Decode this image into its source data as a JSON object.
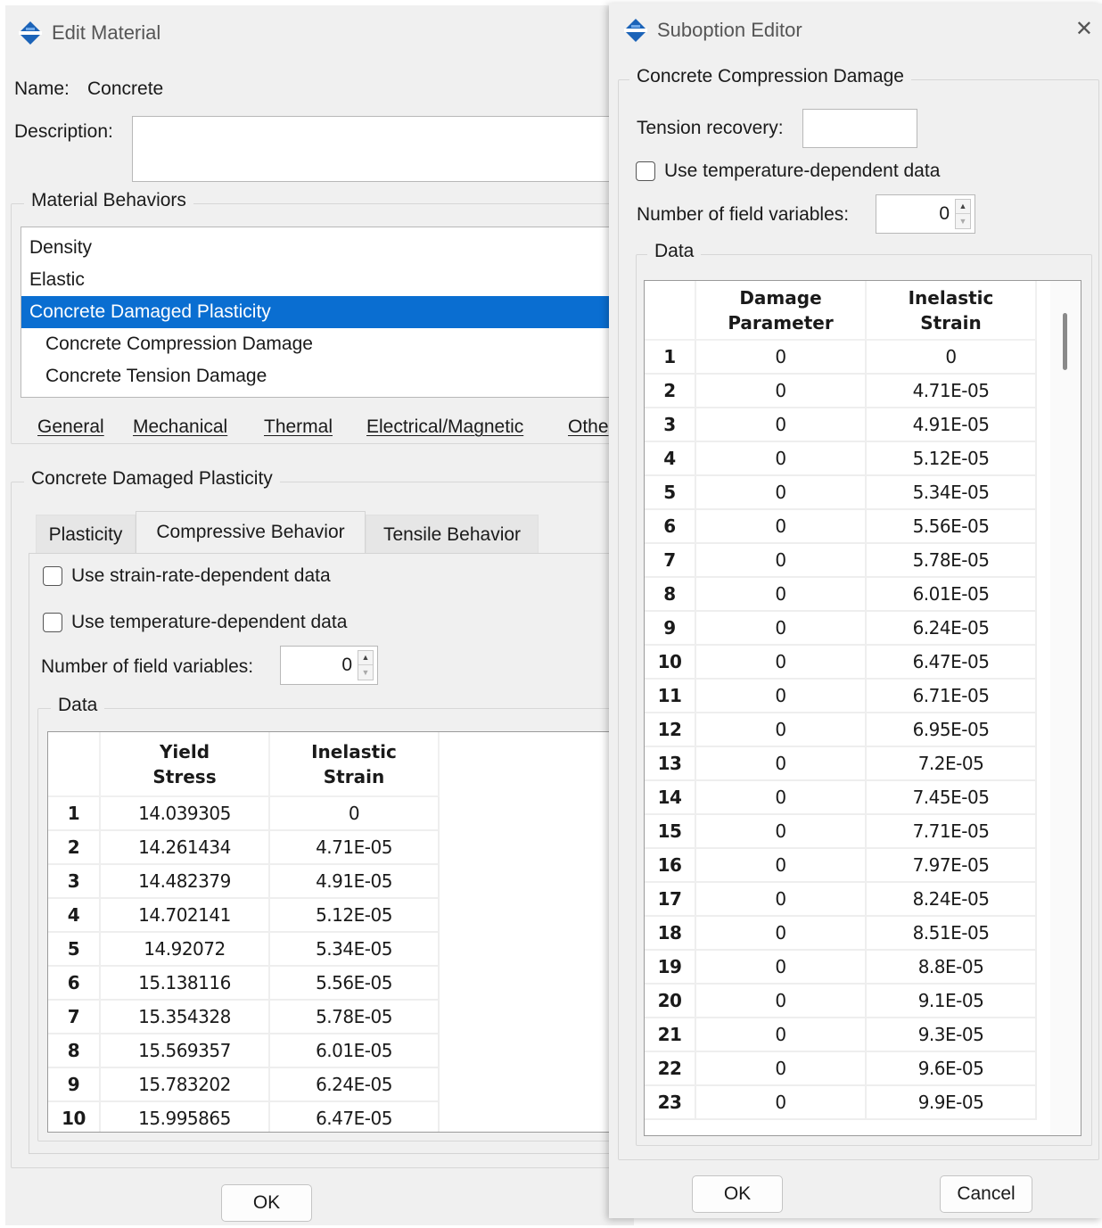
{
  "edit_material": {
    "title": "Edit Material",
    "name_label": "Name:",
    "name_value": "Concrete",
    "description_label": "Description:",
    "description_value": "",
    "behaviors_group": "Material Behaviors",
    "behaviors": [
      {
        "label": "Density"
      },
      {
        "label": "Elastic"
      },
      {
        "label": "Concrete Damaged Plasticity",
        "selected": true
      },
      {
        "label": "Concrete Compression Damage"
      },
      {
        "label": "Concrete Tension Damage"
      }
    ],
    "menus": [
      "General",
      "Mechanical",
      "Thermal",
      "Electrical/Magnetic",
      "Othe"
    ],
    "cdp_group": "Concrete Damaged Plasticity",
    "tabs": [
      "Plasticity",
      "Compressive Behavior",
      "Tensile Behavior"
    ],
    "active_tab": "Compressive Behavior",
    "strain_rate_label": "Use strain-rate-dependent data",
    "temperature_label": "Use temperature-dependent data",
    "field_vars_label": "Number of field variables:",
    "field_vars_value": "0",
    "data_group": "Data",
    "table": {
      "col1": "Yield\nStress",
      "col2": "Inelastic\nStrain",
      "rows": [
        [
          "1",
          "14.039305",
          "0"
        ],
        [
          "2",
          "14.261434",
          "4.71E-05"
        ],
        [
          "3",
          "14.482379",
          "4.91E-05"
        ],
        [
          "4",
          "14.702141",
          "5.12E-05"
        ],
        [
          "5",
          "14.92072",
          "5.34E-05"
        ],
        [
          "6",
          "15.138116",
          "5.56E-05"
        ],
        [
          "7",
          "15.354328",
          "5.78E-05"
        ],
        [
          "8",
          "15.569357",
          "6.01E-05"
        ],
        [
          "9",
          "15.783202",
          "6.24E-05"
        ],
        [
          "10",
          "15.995865",
          "6.47E-05"
        ]
      ]
    },
    "ok_label": "OK"
  },
  "suboption": {
    "title": "Suboption Editor",
    "close_glyph": "✕",
    "group_title": "Concrete Compression Damage",
    "tension_recovery_label": "Tension recovery:",
    "tension_recovery_value": "",
    "temperature_label": "Use temperature-dependent data",
    "field_vars_label": "Number of field variables:",
    "field_vars_value": "0",
    "data_group": "Data",
    "table": {
      "col1": "Damage\nParameter",
      "col2": "Inelastic\nStrain",
      "rows": [
        [
          "1",
          "0",
          "0"
        ],
        [
          "2",
          "0",
          "4.71E-05"
        ],
        [
          "3",
          "0",
          "4.91E-05"
        ],
        [
          "4",
          "0",
          "5.12E-05"
        ],
        [
          "5",
          "0",
          "5.34E-05"
        ],
        [
          "6",
          "0",
          "5.56E-05"
        ],
        [
          "7",
          "0",
          "5.78E-05"
        ],
        [
          "8",
          "0",
          "6.01E-05"
        ],
        [
          "9",
          "0",
          "6.24E-05"
        ],
        [
          "10",
          "0",
          "6.47E-05"
        ],
        [
          "11",
          "0",
          "6.71E-05"
        ],
        [
          "12",
          "0",
          "6.95E-05"
        ],
        [
          "13",
          "0",
          "7.2E-05"
        ],
        [
          "14",
          "0",
          "7.45E-05"
        ],
        [
          "15",
          "0",
          "7.71E-05"
        ],
        [
          "16",
          "0",
          "7.97E-05"
        ],
        [
          "17",
          "0",
          "8.24E-05"
        ],
        [
          "18",
          "0",
          "8.51E-05"
        ],
        [
          "19",
          "0",
          "8.8E-05"
        ],
        [
          "20",
          "0",
          "9.1E-05"
        ],
        [
          "21",
          "0",
          "9.3E-05"
        ],
        [
          "22",
          "0",
          "9.6E-05"
        ],
        [
          "23",
          "0",
          "9.9E-05"
        ]
      ]
    },
    "ok_label": "OK",
    "cancel_label": "Cancel"
  },
  "colors": {
    "window_bg": "#f0f0f0",
    "selection": "#0a6ed1",
    "icon_blue": "#1b63b8"
  },
  "icons": {
    "app_icon": "abaqus-diamond-icon",
    "close": "close-icon"
  }
}
